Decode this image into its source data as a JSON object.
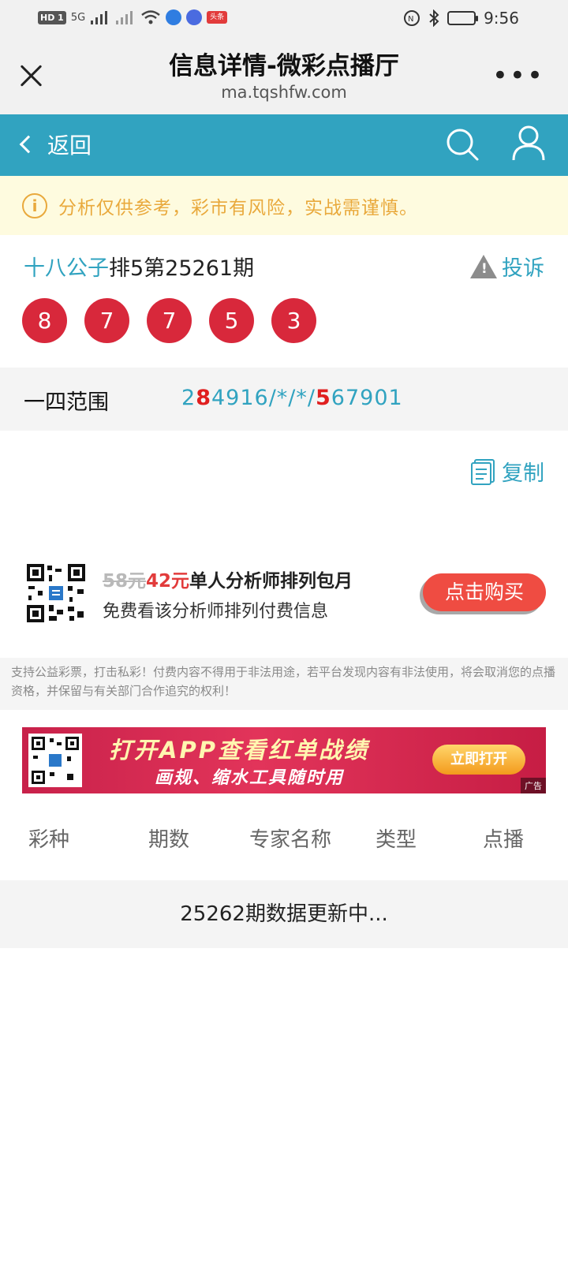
{
  "status_bar": {
    "network": "HD 1",
    "signal1": "5G",
    "time": "9:56",
    "app_badge": "头条"
  },
  "browser": {
    "title": "信息详情-微彩点播厅",
    "url": "ma.tqshfw.com"
  },
  "nav": {
    "back_label": "返回"
  },
  "notice": {
    "icon": "i",
    "text": "分析仅供参考，彩市有风险，实战需谨慎。"
  },
  "issue": {
    "expert": "十八公子",
    "name": "排5第25261期",
    "complain_label": "投诉",
    "balls": [
      "8",
      "7",
      "7",
      "5",
      "3"
    ]
  },
  "range": {
    "label": "一四范围",
    "value_parts": [
      "2",
      "8",
      "4916/*/*/",
      "5",
      "67901"
    ]
  },
  "copy_label": "复制",
  "promo": {
    "old_price": "58元",
    "new_price": "42元",
    "desc": "单人分析师排列包月",
    "sub": "免费看该分析师排列付费信息",
    "buy_label": "点击购买"
  },
  "disclaimer": "支持公益彩票，打击私彩！付费内容不得用于非法用途，若平台发现内容有非法使用，将会取消您的点播资格，并保留与有关部门合作追究的权利！",
  "ad": {
    "line1": "打开APP查看红单战绩",
    "line2": "画规、缩水工具随时用",
    "open_label": "立即打开",
    "tag": "广告"
  },
  "table": {
    "headers": [
      "彩种",
      "期数",
      "专家名称",
      "类型",
      "点播"
    ],
    "empty_text": "25262期数据更新中..."
  },
  "colors": {
    "accent": "#31a3c0",
    "ball": "#d8283b",
    "notice_text": "#e9a93c",
    "buy": "#ef4c42"
  }
}
